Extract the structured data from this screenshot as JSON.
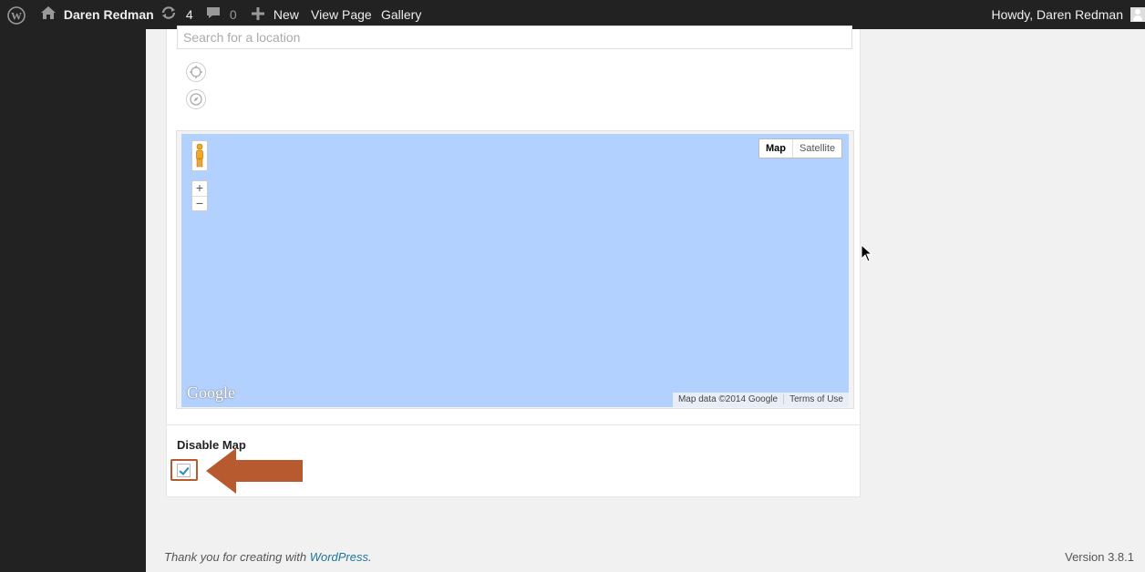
{
  "adminbar": {
    "site_name": "Daren Redman",
    "updates_count": "4",
    "comments_count": "0",
    "new_label": "New",
    "view_page_label": "View Page",
    "gallery_label": "Gallery",
    "howdy_label": "Howdy, Daren Redman"
  },
  "location": {
    "search_placeholder": "Search for a location"
  },
  "map": {
    "map_type_options": [
      "Map",
      "Satellite"
    ],
    "selected_map_type": "Map",
    "zoom_in": "+",
    "zoom_out": "−",
    "logo": "Google",
    "attribution": "Map data ©2014 Google",
    "terms": "Terms of Use",
    "water_color": "#b3d1ff"
  },
  "disable_map": {
    "label": "Disable Map",
    "checked": true
  },
  "footer": {
    "thanks_prefix": "Thank you for creating with ",
    "wordpress_link": "WordPress",
    "thanks_suffix": ".",
    "version": "Version 3.8.1"
  },
  "colors": {
    "adminbar_bg": "#222222",
    "link": "#21759b",
    "highlight_arrow": "#b85a2f"
  }
}
